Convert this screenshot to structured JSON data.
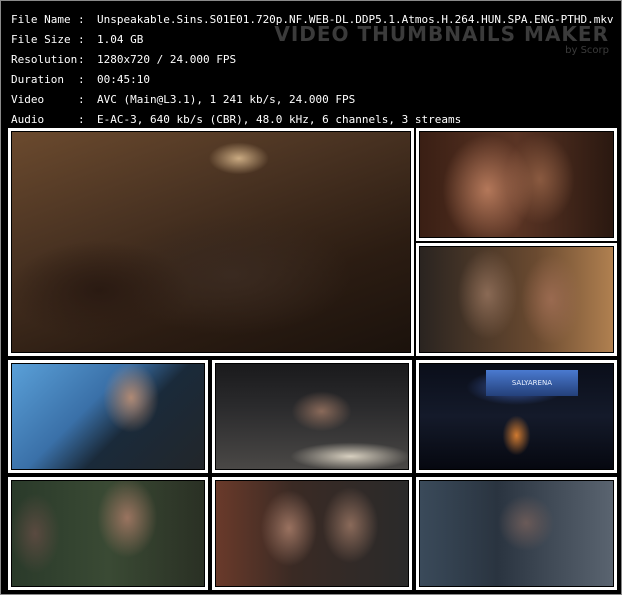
{
  "info": {
    "rows": [
      {
        "label": "File Name",
        "sep": ":",
        "value": "Unspeakable.Sins.S01E01.720p.NF.WEB-DL.DDP5.1.Atmos.H.264.HUN.SPA.ENG-PTHD.mkv"
      },
      {
        "label": "File Size",
        "sep": ":",
        "value": "1.04 GB"
      },
      {
        "label": "Resolution",
        "sep": ":",
        "value": "1280x720 / 24.000 FPS"
      },
      {
        "label": "Duration",
        "sep": ":",
        "value": "00:45:10"
      },
      {
        "label": "Video",
        "sep": ":",
        "value": "AVC (Main@L3.1), 1 241 kb/s, 24.000 FPS"
      },
      {
        "label": "Audio",
        "sep": ":",
        "value": "E-AC-3, 640 kb/s (CBR), 48.0 kHz, 6 channels, 3 streams"
      }
    ]
  },
  "watermark": {
    "title": "VIDEO THUMBNAILS MAKER",
    "subtitle": "by Scorp"
  },
  "frames": {
    "arena_sign": "SALYARENA"
  },
  "colors": {
    "background": "#000000",
    "text": "#ffffff",
    "thumb_border": "#ffffff",
    "watermark": "#3b3b3b"
  }
}
